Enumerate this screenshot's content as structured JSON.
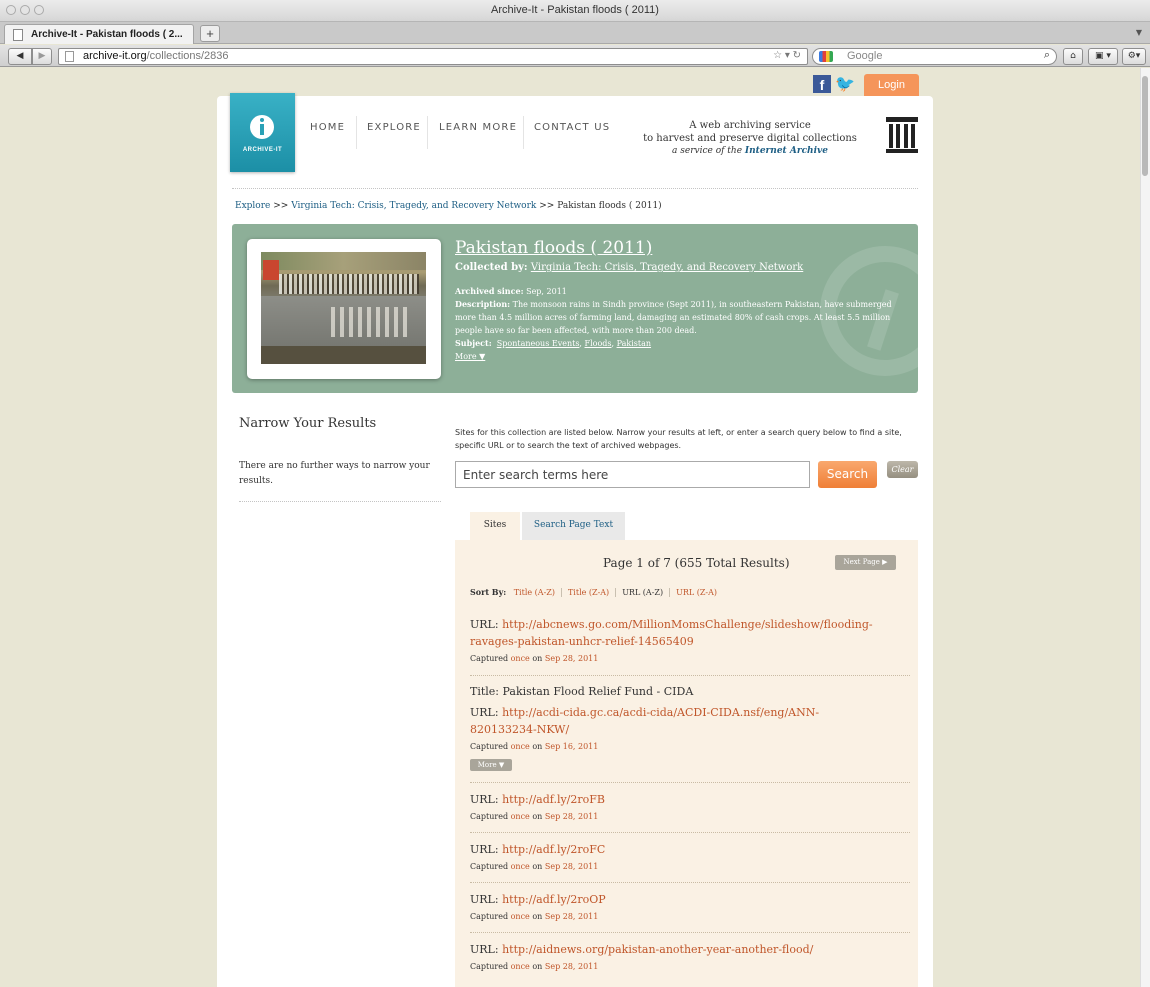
{
  "browser": {
    "window_title": "Archive-It - Pakistan floods ( 2011)",
    "tab_title": "Archive-It - Pakistan floods ( 2...",
    "new_tab": "+",
    "url_domain": "archive-it.org",
    "url_path": "/collections/2836",
    "search_placeholder": "Google"
  },
  "header": {
    "login": "Login",
    "logo_text": "ARCHIVE-IT",
    "nav": [
      "HOME",
      "EXPLORE",
      "LEARN MORE",
      "CONTACT US"
    ],
    "tagline_1": "A web archiving service",
    "tagline_2": "to harvest and preserve digital collections",
    "tagline_3_prefix": "a service of the ",
    "tagline_3_link": "Internet Archive"
  },
  "breadcrumb": {
    "root": "Explore",
    "sep": ">>",
    "parent": "Virginia Tech: Crisis, Tragedy, and Recovery Network",
    "current": "Pakistan floods ( 2011)"
  },
  "collection": {
    "title": "Pakistan floods ( 2011)",
    "collected_by_label": "Collected by:",
    "collected_by": "Virginia Tech: Crisis, Tragedy, and Recovery Network",
    "archived_since_label": "Archived since:",
    "archived_since": "Sep, 2011",
    "description_label": "Description:",
    "description": "The monsoon rains in Sindh province (Sept 2011), in southeastern Pakistan, have submerged more than 4.5 million acres of farming land, damaging an estimated 80% of cash crops. At least 5.5 million people have so far been affected, with more than 200 dead.",
    "subject_label": "Subject:",
    "subjects": [
      "Spontaneous Events",
      "Floods",
      "Pakistan"
    ],
    "more": "More ▼"
  },
  "sidebar": {
    "title": "Narrow Your Results",
    "text": "There are no further ways to narrow your results."
  },
  "search": {
    "intro": "Sites for this collection are listed below. Narrow your results at left, or enter a search query below to find a site, specific URL or to search the text of archived webpages.",
    "placeholder": "Enter search terms here",
    "button": "Search",
    "clear": "Clear"
  },
  "tabs": [
    "Sites",
    "Search Page Text"
  ],
  "results": {
    "page_info": "Page 1 of 7 (655 Total Results)",
    "next_page": "Next Page ▶",
    "sort_label": "Sort By:",
    "sort_options": [
      "Title (A-Z)",
      "Title (Z-A)",
      "URL (A-Z)",
      "URL (Z-A)"
    ],
    "url_label": "URL:",
    "title_label": "Title:",
    "captured_prefix": "Captured",
    "once": "once",
    "on": "on",
    "more_btn": "More ▼",
    "items": [
      {
        "url_1": "http://abcnews.go.com/MillionMomsChallenge/slideshow/flooding-",
        "url_2": "ravages-pakistan-unhcr-relief-14565409",
        "date": "Sep 28, 2011"
      },
      {
        "title": "Pakistan Flood Relief Fund - CIDA",
        "url_1": "http://acdi-cida.gc.ca/acdi-cida/ACDI-CIDA.nsf/eng/ANN-",
        "url_2": "820133234-NKW/",
        "date": "Sep 16, 2011"
      },
      {
        "url_1": "http://adf.ly/2roFB",
        "date": "Sep 28, 2011"
      },
      {
        "url_1": "http://adf.ly/2roFC",
        "date": "Sep 28, 2011"
      },
      {
        "url_1": "http://adf.ly/2roOP",
        "date": "Sep 28, 2011"
      },
      {
        "url_1": "http://aidnews.org/pakistan-another-year-another-flood/",
        "date": "Sep 28, 2011"
      }
    ]
  }
}
